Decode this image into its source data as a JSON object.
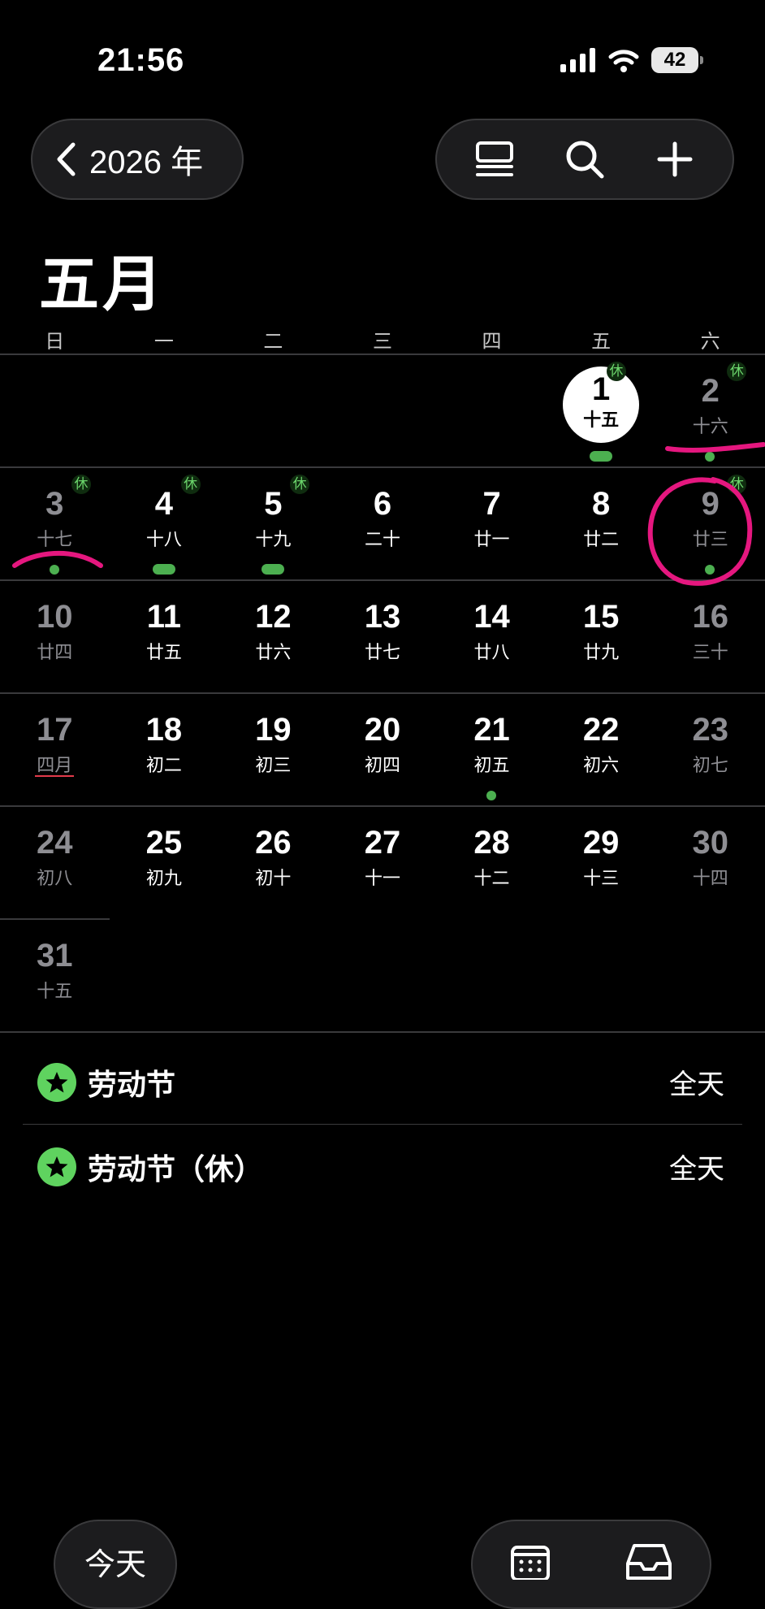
{
  "status_bar": {
    "time": "21:56",
    "battery": "42"
  },
  "nav": {
    "back_label": "2026 年"
  },
  "month_title": "五月",
  "weekdays": [
    "日",
    "一",
    "二",
    "三",
    "四",
    "五",
    "六"
  ],
  "holiday_badge": "休",
  "days": [
    {
      "n": "1",
      "lunar": "十五",
      "today": true,
      "xiu": true,
      "marker": "bar"
    },
    {
      "n": "2",
      "lunar": "十六",
      "xiu": true,
      "marker": "dot"
    },
    {
      "n": "3",
      "lunar": "十七",
      "xiu": true,
      "marker": "dot"
    },
    {
      "n": "4",
      "lunar": "十八",
      "xiu": true,
      "marker": "bar"
    },
    {
      "n": "5",
      "lunar": "十九",
      "xiu": true,
      "marker": "bar"
    },
    {
      "n": "6",
      "lunar": "二十"
    },
    {
      "n": "7",
      "lunar": "廿一"
    },
    {
      "n": "8",
      "lunar": "廿二"
    },
    {
      "n": "9",
      "lunar": "廿三",
      "xiu": true,
      "marker": "dot"
    },
    {
      "n": "10",
      "lunar": "廿四"
    },
    {
      "n": "11",
      "lunar": "廿五"
    },
    {
      "n": "12",
      "lunar": "廿六"
    },
    {
      "n": "13",
      "lunar": "廿七"
    },
    {
      "n": "14",
      "lunar": "廿八"
    },
    {
      "n": "15",
      "lunar": "廿九"
    },
    {
      "n": "16",
      "lunar": "三十"
    },
    {
      "n": "17",
      "lunar": "四月",
      "lunar_underline": true
    },
    {
      "n": "18",
      "lunar": "初二"
    },
    {
      "n": "19",
      "lunar": "初三"
    },
    {
      "n": "20",
      "lunar": "初四"
    },
    {
      "n": "21",
      "lunar": "初五",
      "marker": "dot"
    },
    {
      "n": "22",
      "lunar": "初六"
    },
    {
      "n": "23",
      "lunar": "初七"
    },
    {
      "n": "24",
      "lunar": "初八"
    },
    {
      "n": "25",
      "lunar": "初九"
    },
    {
      "n": "26",
      "lunar": "初十"
    },
    {
      "n": "27",
      "lunar": "十一"
    },
    {
      "n": "28",
      "lunar": "十二"
    },
    {
      "n": "29",
      "lunar": "十三"
    },
    {
      "n": "30",
      "lunar": "十四"
    },
    {
      "n": "31",
      "lunar": "十五"
    }
  ],
  "events": [
    {
      "title": "劳动节",
      "time": "全天",
      "icon": "star-icon"
    },
    {
      "title": "劳动节（休）",
      "time": "全天",
      "icon": "star-icon"
    }
  ],
  "bottom_bar": {
    "today_label": "今天",
    "icons": [
      "calendar-grid-icon",
      "inbox-icon"
    ]
  },
  "colors": {
    "accent_green": "#4caf50",
    "annotation_magenta": "#e5177f",
    "today_underline": "#e23a4a"
  }
}
